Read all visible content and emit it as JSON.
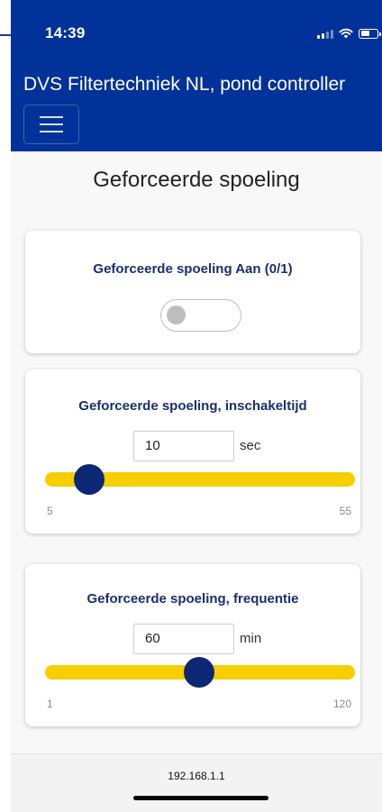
{
  "status_bar": {
    "time": "14:39"
  },
  "header": {
    "title": "DVS Filtertechniek NL, pond controller",
    "menu_icon": "hamburger-icon"
  },
  "page": {
    "title": "Geforceerde spoeling"
  },
  "forced_flush_toggle": {
    "label": "Geforceerde spoeling Aan (0/1)",
    "on": false
  },
  "on_time": {
    "label": "Geforceerde spoeling, inschakeltijd",
    "value": "10",
    "unit": "sec",
    "min": "5",
    "max": "55"
  },
  "frequency": {
    "label": "Geforceerde spoeling, frequentie",
    "value": "60",
    "unit": "min",
    "min": "1",
    "max": "120"
  },
  "footer": {
    "url": "192.168.1.1"
  },
  "colors": {
    "header_bg": "#003299",
    "slider_track": "#f7ce00",
    "slider_thumb": "#0c2875",
    "card_title": "#1a2f6e"
  }
}
